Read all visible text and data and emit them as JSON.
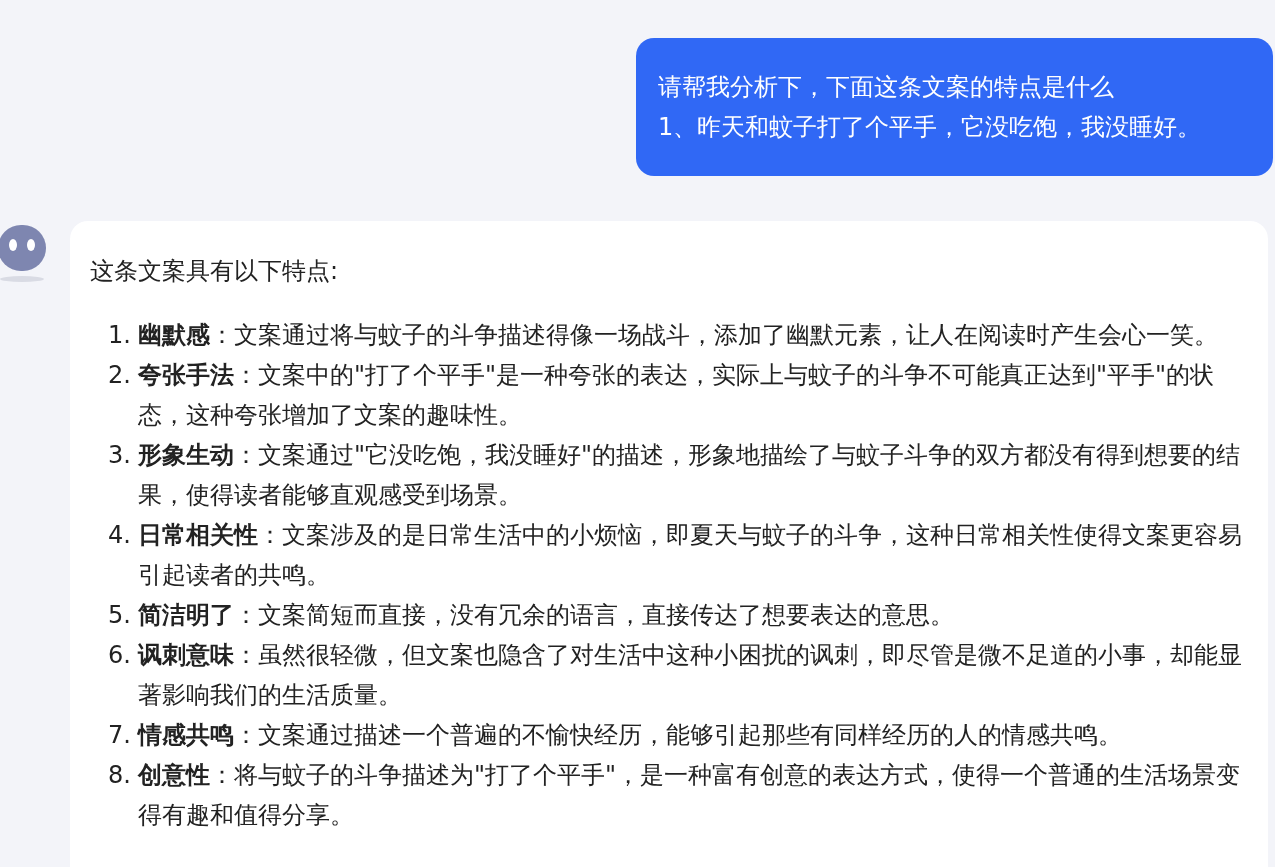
{
  "user_message": {
    "lines": [
      "请帮我分析下，下面这条文案的特点是什么",
      "1、昨天和蚊子打了个平手，它没吃饱，我没睡好。"
    ]
  },
  "assistant_message": {
    "intro": "这条文案具有以下特点:",
    "items": [
      {
        "number": "1.",
        "text": "**幽默感**：文案通过将与蚊子的斗争描述得像一场战斗，添加了幽默元素，让人在阅读时产生会心一笑。"
      },
      {
        "number": "2.",
        "text": "**夸张手法**：文案中的\"打了个平手\"是一种夸张的表达，实际上与蚊子的斗争不可能真正达到\"平手\"的状态，这种夸张增加了文案的趣味性。"
      },
      {
        "number": "3.",
        "text": "**形象生动**：文案通过\"它没吃饱，我没睡好\"的描述，形象地描绘了与蚊子斗争的双方都没有得到想要的结果，使得读者能够直观感受到场景。"
      },
      {
        "number": "4.",
        "text": "**日常相关性**：文案涉及的是日常生活中的小烦恼，即夏天与蚊子的斗争，这种日常相关性使得文案更容易引起读者的共鸣。"
      },
      {
        "number": "5.",
        "text": "**简洁明了**：文案简短而直接，没有冗余的语言，直接传达了想要表达的意思。"
      },
      {
        "number": "6.",
        "text": "**讽刺意味**：虽然很轻微，但文案也隐含了对生活中这种小困扰的讽刺，即尽管是微不足道的小事，却能显著影响我们的生活质量。"
      },
      {
        "number": "7.",
        "text": "**情感共鸣**：文案通过描述一个普遍的不愉快经历，能够引起那些有同样经历的人的情感共鸣。"
      },
      {
        "number": "8.",
        "text": "**创意性**：将与蚊子的斗争描述为\"打了个平手\"，是一种富有创意的表达方式，使得一个普通的生活场景变得有趣和值得分享。"
      }
    ]
  }
}
